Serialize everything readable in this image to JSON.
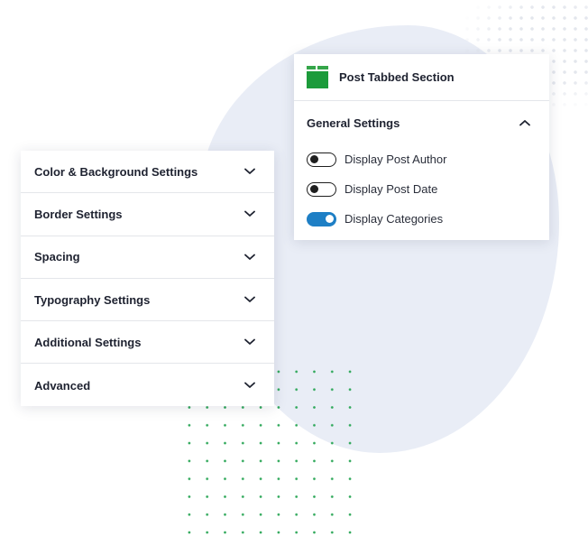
{
  "left_panel": {
    "items": [
      {
        "label": "Color & Background Settings"
      },
      {
        "label": "Border Settings"
      },
      {
        "label": "Spacing"
      },
      {
        "label": "Typography Settings"
      },
      {
        "label": "Additional Settings"
      },
      {
        "label": "Advanced"
      }
    ],
    "chevron_icon": "chevron-down-icon"
  },
  "right_panel": {
    "block_title": "Post Tabbed Section",
    "block_icon": "tabbed-block-icon",
    "section_title": "General Settings",
    "section_icon": "chevron-up-icon",
    "toggles": [
      {
        "label": "Display Post Author",
        "on": false
      },
      {
        "label": "Display Post Date",
        "on": false
      },
      {
        "label": "Display Categories",
        "on": true
      }
    ]
  },
  "colors": {
    "accent_toggle": "#1e7fc5",
    "block_icon_green": "#1c9b3b",
    "dots_green": "#2fa85a",
    "blob": "#e9edf6"
  }
}
